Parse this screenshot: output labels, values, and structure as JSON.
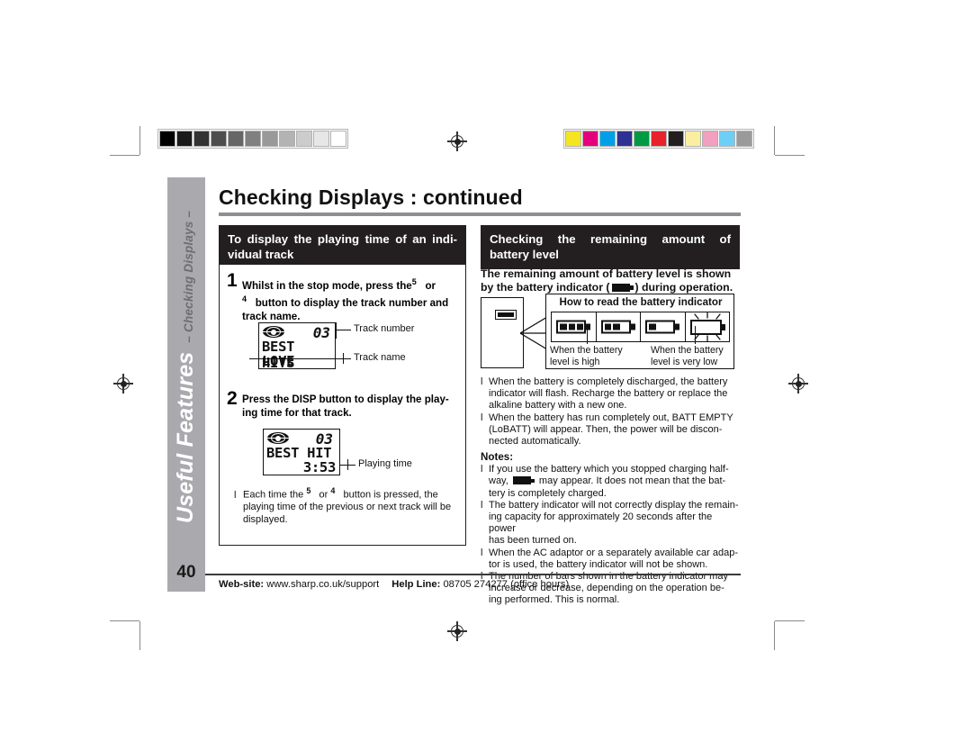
{
  "page": {
    "number": "40",
    "title": "Checking Displays : continued",
    "sidebar": {
      "main": "Useful Features",
      "sub": "– Checking Displays –"
    }
  },
  "left_column": {
    "header": "To display the playing time of an individual track",
    "header_line1": "To display the playing time of an indi-",
    "header_line2": "vidual track",
    "step1": {
      "number": "1",
      "line1_a": "Whilst in the stop mode, press the",
      "line1_sup": "5",
      "line1_b": "or",
      "line2_sup": "4",
      "line2_a": "button to display the track number and",
      "line3": "track name."
    },
    "lcd1": {
      "track_number": "03",
      "track_title": "BEST HITS",
      "track_name": "LOVE",
      "callout_number": "Track number",
      "callout_name": "Track name"
    },
    "step2": {
      "number": "2",
      "line1": "Press the DISP button to display the play-",
      "line2": "ing time for that track."
    },
    "lcd2": {
      "track_number": "03",
      "track_title": "BEST HIT",
      "playing_time": "3:53",
      "callout_time": "Playing time"
    },
    "note": {
      "marker": "l",
      "line1_a": "Each time the",
      "line1_sup1": "5",
      "line1_mid": "or",
      "line1_sup2": "4",
      "line1_b": "button is pressed, the",
      "line2": "playing time of the previous or next track will be",
      "line3": "displayed."
    }
  },
  "right_column": {
    "header_line1": "Checking the remaining amount of",
    "header_line2": "battery level",
    "lead_a": "The remaining amount of battery level is shown",
    "lead_b": "by the battery indicator (",
    "lead_c": ") during operation.",
    "battery_box": {
      "title": "How to read the battery indicator",
      "caption_high_line1": "When the battery",
      "caption_high_line2": "level is high",
      "caption_low_line1": "When the battery",
      "caption_low_line2": "level is very low",
      "states": [
        {
          "name": "full",
          "bars": 3,
          "flashing": false
        },
        {
          "name": "medium",
          "bars": 2,
          "flashing": false
        },
        {
          "name": "low",
          "bars": 1,
          "flashing": false
        },
        {
          "name": "empty",
          "bars": 0,
          "flashing": true
        }
      ]
    },
    "bullets": [
      {
        "marker": "l",
        "lines": [
          "When the battery is completely discharged, the battery",
          "indicator will flash. Recharge the battery or replace the",
          "alkaline battery with a new one."
        ]
      },
      {
        "marker": "l",
        "lines": [
          "When the battery has run completely out,  BATT EMPTY",
          "(LoBATT)  will appear. Then, the power will be discon-",
          "nected automatically."
        ]
      }
    ],
    "notes_heading": "Notes:",
    "notes": [
      {
        "marker": "l",
        "lines": [
          "If you use the battery which you stopped charging half-",
          "way,  @BATT@  may appear. It does not mean that the bat-",
          "tery is completely charged."
        ]
      },
      {
        "marker": "l",
        "lines": [
          "The battery indicator will not correctly display the remain-",
          "ing capacity for approximately 20 seconds after the power",
          "has been turned on."
        ]
      },
      {
        "marker": "l",
        "lines": [
          "When the AC adaptor or a separately available car adap-",
          "tor is used, the battery indicator will not be shown."
        ]
      },
      {
        "marker": "l",
        "lines": [
          "The number of bars shown in the battery indicator may",
          "increase or decrease, depending on the operation be-",
          "ing performed. This is normal."
        ]
      }
    ]
  },
  "footer": {
    "website_label": "Web-site:",
    "website_value": "www.sharp.co.uk/support",
    "helpline_label": "Help Line:",
    "helpline_value": "08705 274277 (office hours)"
  },
  "print_marks": {
    "grayscale_swatches": [
      "#000000",
      "#1a1a1a",
      "#333333",
      "#4d4d4d",
      "#666666",
      "#808080",
      "#999999",
      "#b3b3b3",
      "#cccccc",
      "#e6e6e6",
      "#ffffff"
    ],
    "color_swatches": [
      "#f4e520",
      "#e5007e",
      "#00a0e9",
      "#2e3192",
      "#009a44",
      "#e8222a",
      "#231f20",
      "#faeea0",
      "#f2a0c0",
      "#6ecff6",
      "#9a9a9a"
    ]
  }
}
